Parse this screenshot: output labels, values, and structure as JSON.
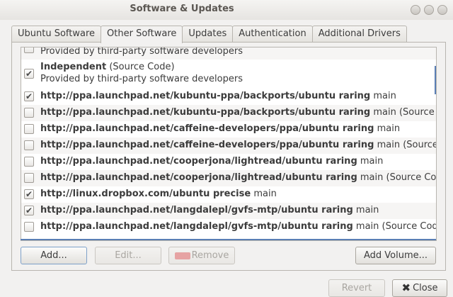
{
  "window": {
    "title": "Software & Updates"
  },
  "tabs": [
    {
      "label": "Ubuntu Software",
      "active": false
    },
    {
      "label": "Other Software",
      "active": true
    },
    {
      "label": "Updates",
      "active": false
    },
    {
      "label": "Authentication",
      "active": false
    },
    {
      "label": "Additional Drivers",
      "active": false
    }
  ],
  "sources": [
    {
      "bold": "",
      "rest": "Provided by third-party software developers",
      "checked": false,
      "tall": false
    },
    {
      "bold": "Independent",
      "rest": " (Source Code)",
      "line2": "Provided by third-party software developers",
      "checked": true,
      "tall": true
    },
    {
      "bold": "http://ppa.launchpad.net/kubuntu-ppa/backports/ubuntu raring",
      "rest": " main",
      "checked": true
    },
    {
      "bold": "http://ppa.launchpad.net/kubuntu-ppa/backports/ubuntu raring",
      "rest": " main (Source Code)",
      "checked": false
    },
    {
      "bold": "http://ppa.launchpad.net/caffeine-developers/ppa/ubuntu raring",
      "rest": " main",
      "checked": false
    },
    {
      "bold": "http://ppa.launchpad.net/caffeine-developers/ppa/ubuntu raring",
      "rest": " main (Source Code)",
      "checked": false
    },
    {
      "bold": "http://ppa.launchpad.net/cooperjona/lightread/ubuntu raring",
      "rest": " main",
      "checked": false
    },
    {
      "bold": "http://ppa.launchpad.net/cooperjona/lightread/ubuntu raring",
      "rest": " main (Source Code)",
      "checked": false
    },
    {
      "bold": "http://linux.dropbox.com/ubuntu precise",
      "rest": " main",
      "checked": true
    },
    {
      "bold": "http://ppa.launchpad.net/langdalepl/gvfs-mtp/ubuntu raring",
      "rest": " main",
      "checked": true
    },
    {
      "bold": "http://ppa.launchpad.net/langdalepl/gvfs-mtp/ubuntu raring",
      "rest": " main (Source Code)",
      "checked": false
    }
  ],
  "buttons": {
    "add": "Add...",
    "edit": "Edit...",
    "remove": "Remove",
    "add_volume": "Add Volume...",
    "revert": "Revert",
    "close": "Close"
  }
}
